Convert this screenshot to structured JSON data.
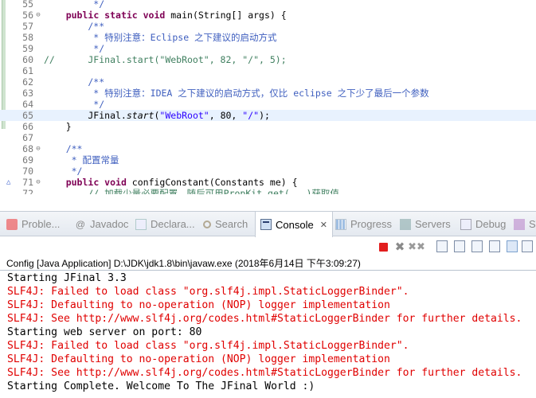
{
  "editor": {
    "lines": [
      {
        "n": "55",
        "fold": "",
        "segments": [
          {
            "t": "         */",
            "c": "jd"
          }
        ]
      },
      {
        "n": "56",
        "fold": "⊖",
        "segments": [
          {
            "t": "    ",
            "c": "pl"
          },
          {
            "t": "public static void",
            "c": "kw"
          },
          {
            "t": " main(String[] ",
            "c": "pl"
          },
          {
            "t": "args",
            "c": "pl"
          },
          {
            "t": ") {",
            "c": "pl"
          }
        ]
      },
      {
        "n": "57",
        "fold": "",
        "segments": [
          {
            "t": "        /**",
            "c": "jd"
          }
        ]
      },
      {
        "n": "58",
        "fold": "",
        "segments": [
          {
            "t": "         * 特别注意：Eclipse 之下建议的启动方式",
            "c": "jd"
          }
        ]
      },
      {
        "n": "59",
        "fold": "",
        "segments": [
          {
            "t": "         */",
            "c": "jd"
          }
        ]
      },
      {
        "n": "60",
        "fold": "",
        "segments": [
          {
            "t": "//      JFinal.start(\"WebRoot\", 82, \"/\", 5);",
            "c": "cm"
          }
        ]
      },
      {
        "n": "61",
        "fold": "",
        "segments": []
      },
      {
        "n": "62",
        "fold": "",
        "segments": [
          {
            "t": "        /**",
            "c": "jd"
          }
        ]
      },
      {
        "n": "63",
        "fold": "",
        "segments": [
          {
            "t": "         * 特别注意：IDEA 之下建议的启动方式，仅比 eclipse 之下少了最后一个参数",
            "c": "jd"
          }
        ]
      },
      {
        "n": "64",
        "fold": "",
        "segments": [
          {
            "t": "         */",
            "c": "jd"
          }
        ]
      },
      {
        "n": "65",
        "fold": "",
        "current": true,
        "segments": [
          {
            "t": "        JFinal.",
            "c": "pl"
          },
          {
            "t": "start",
            "c": "pl it"
          },
          {
            "t": "(",
            "c": "pl"
          },
          {
            "t": "\"WebRoot\"",
            "c": "st"
          },
          {
            "t": ", 80, ",
            "c": "pl"
          },
          {
            "t": "\"/\"",
            "c": "st"
          },
          {
            "t": ");",
            "c": "pl"
          }
        ]
      },
      {
        "n": "66",
        "fold": "",
        "segments": [
          {
            "t": "    }",
            "c": "pl"
          }
        ]
      },
      {
        "n": "67",
        "fold": "",
        "segments": []
      },
      {
        "n": "68",
        "fold": "⊖",
        "segments": [
          {
            "t": "    /**",
            "c": "jd"
          }
        ]
      },
      {
        "n": "69",
        "fold": "",
        "segments": [
          {
            "t": "     * 配置常量",
            "c": "jd"
          }
        ]
      },
      {
        "n": "70",
        "fold": "",
        "segments": [
          {
            "t": "     */",
            "c": "jd"
          }
        ]
      },
      {
        "n": "71",
        "fold": "⊖",
        "warn": "△",
        "segments": [
          {
            "t": "    ",
            "c": "pl"
          },
          {
            "t": "public void",
            "c": "kw"
          },
          {
            "t": " configConstant(Constants ",
            "c": "pl"
          },
          {
            "t": "me",
            "c": "pl"
          },
          {
            "t": ") {",
            "c": "pl"
          }
        ]
      },
      {
        "n": "72",
        "fold": "",
        "segments": [
          {
            "t": "        // 加载少量必要配置，随后可用PropKit.get(...)获取值",
            "c": "cm"
          }
        ]
      }
    ]
  },
  "tabs": [
    {
      "key": "problems",
      "label": "Proble...",
      "icon": "problems-icon"
    },
    {
      "key": "javadoc",
      "label": "Javadoc",
      "icon": "javadoc-icon"
    },
    {
      "key": "declaration",
      "label": "Declara...",
      "icon": "declaration-icon"
    },
    {
      "key": "search",
      "label": "Search",
      "icon": "search-icon"
    },
    {
      "key": "console",
      "label": "Console",
      "icon": "console-icon",
      "active": true,
      "close": "✕"
    },
    {
      "key": "progress",
      "label": "Progress",
      "icon": "progress-icon"
    },
    {
      "key": "servers",
      "label": "Servers",
      "icon": "servers-icon"
    },
    {
      "key": "debug",
      "label": "Debug",
      "icon": "debug-icon"
    },
    {
      "key": "sv",
      "label": "SV",
      "icon": "sv-icon"
    }
  ],
  "console": {
    "header": "Config [Java Application] D:\\JDK\\jdk1.8\\bin\\javaw.exe (2018年6月14日 下午3:09:27)",
    "lines": [
      {
        "text": "Starting JFinal 3.3",
        "stream": "stdout"
      },
      {
        "text": "SLF4J: Failed to load class \"org.slf4j.impl.StaticLoggerBinder\".",
        "stream": "stderr"
      },
      {
        "text": "SLF4J: Defaulting to no-operation (NOP) logger implementation",
        "stream": "stderr"
      },
      {
        "text": "SLF4J: See http://www.slf4j.org/codes.html#StaticLoggerBinder for further details.",
        "stream": "stderr"
      },
      {
        "text": "Starting web server on port: 80",
        "stream": "stdout"
      },
      {
        "text": "SLF4J: Failed to load class \"org.slf4j.impl.StaticLoggerBinder\".",
        "stream": "stderr"
      },
      {
        "text": "SLF4J: Defaulting to no-operation (NOP) logger implementation",
        "stream": "stderr"
      },
      {
        "text": "SLF4J: See http://www.slf4j.org/codes.html#StaticLoggerBinder for further details.",
        "stream": "stderr"
      },
      {
        "text": "Starting Complete. Welcome To The JFinal World :)",
        "stream": "stdout"
      }
    ]
  },
  "toolbar": {
    "buttons": [
      {
        "name": "terminate-icon",
        "cls": "stop"
      },
      {
        "name": "remove-launch-icon",
        "cls": "remove",
        "glyph": "✖"
      },
      {
        "name": "remove-all-terminated-icon",
        "cls": "removeall",
        "glyph": "✖✖"
      },
      {
        "name": "clear-console-icon",
        "cls": "doc"
      },
      {
        "name": "scroll-lock-icon",
        "cls": "doc"
      },
      {
        "name": "word-wrap-icon",
        "cls": "doc"
      },
      {
        "name": "pin-console-icon",
        "cls": "doc"
      },
      {
        "name": "display-selected-console-icon",
        "cls": "doc pressed"
      },
      {
        "name": "open-console-icon",
        "cls": "doc"
      }
    ]
  },
  "colors": {
    "keyword": "#7f0055",
    "javadoc": "#3f5fbf",
    "comment": "#3f7f5f",
    "string": "#2a00ff",
    "stderr": "#e00000",
    "current_line": "#e8f2fe"
  }
}
